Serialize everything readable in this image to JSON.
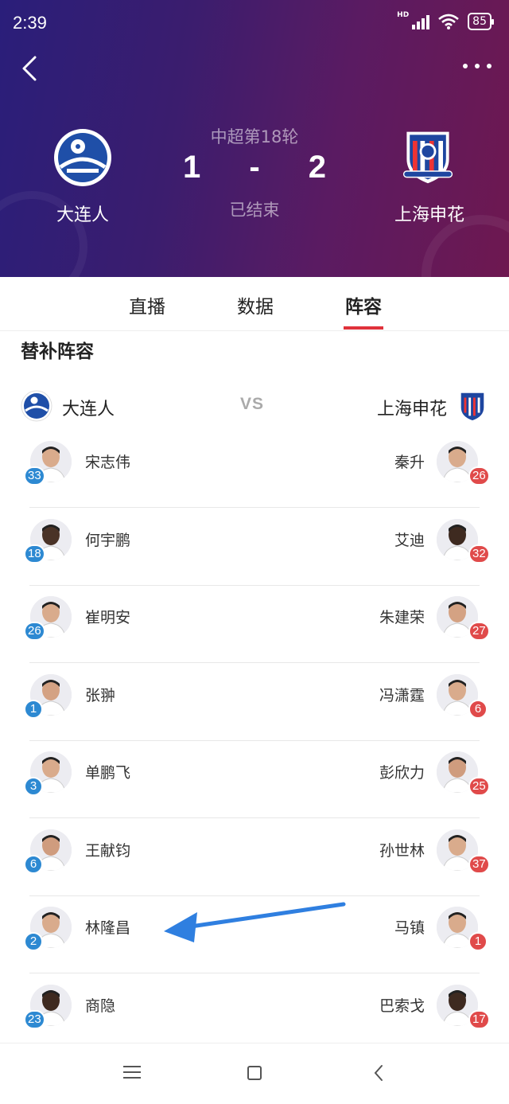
{
  "status_bar": {
    "time": "2:39",
    "network": "HD",
    "battery": "85"
  },
  "match": {
    "round": "中超第18轮",
    "home_score": "1",
    "separator": "-",
    "away_score": "2",
    "status": "已结束",
    "home": {
      "name": "大连人",
      "logo": "dalian-pro-logo"
    },
    "away": {
      "name": "上海申花",
      "logo": "shanghai-shenhua-logo"
    }
  },
  "tabs": [
    "直播",
    "数据",
    "阵容"
  ],
  "active_tab": "阵容",
  "section_title": "替补阵容",
  "vs_label": "VS",
  "subs": [
    {
      "home": {
        "name": "宋志伟",
        "number": "33"
      },
      "away": {
        "name": "秦升",
        "number": "26"
      }
    },
    {
      "home": {
        "name": "何宇鹏",
        "number": "18"
      },
      "away": {
        "name": "艾迪",
        "number": "32"
      }
    },
    {
      "home": {
        "name": "崔明安",
        "number": "26"
      },
      "away": {
        "name": "朱建荣",
        "number": "27"
      }
    },
    {
      "home": {
        "name": "张翀",
        "number": "1"
      },
      "away": {
        "name": "冯潇霆",
        "number": "6"
      }
    },
    {
      "home": {
        "name": "单鹏飞",
        "number": "3"
      },
      "away": {
        "name": "彭欣力",
        "number": "25"
      }
    },
    {
      "home": {
        "name": "王献钧",
        "number": "6"
      },
      "away": {
        "name": "孙世林",
        "number": "37"
      }
    },
    {
      "home": {
        "name": "林隆昌",
        "number": "2"
      },
      "away": {
        "name": "马镇",
        "number": "1"
      }
    },
    {
      "home": {
        "name": "商隐",
        "number": "23"
      },
      "away": {
        "name": "巴索戈",
        "number": "17"
      }
    }
  ],
  "colors": {
    "home_badge": "#2d89d2",
    "away_badge": "#e04a4a",
    "tab_accent": "#e0323b",
    "annotation_arrow": "#2f7fe0"
  },
  "nav_bar": [
    "menu-icon",
    "home-icon",
    "back-icon"
  ]
}
